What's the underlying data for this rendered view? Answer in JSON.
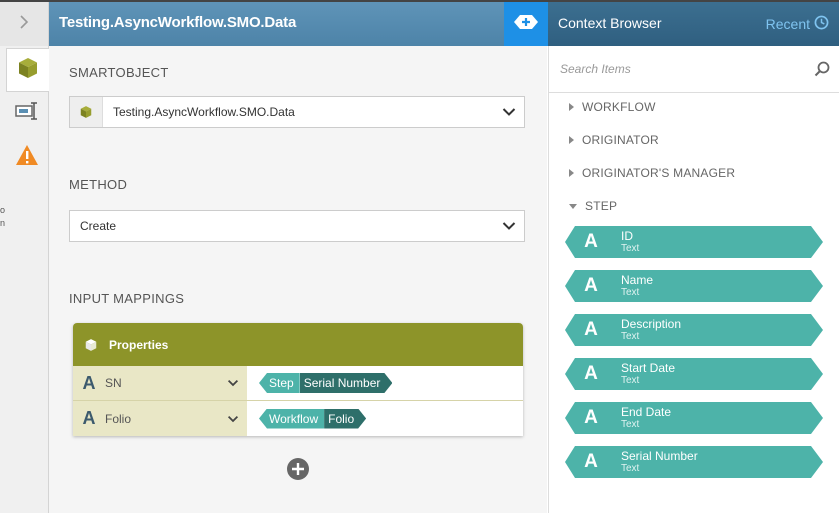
{
  "header": {
    "title": "Testing.AsyncWorkflow.SMO.Data"
  },
  "colors": {
    "header_blue": "#5b91b5",
    "add_button": "#1e90e6",
    "context_header": "#356586",
    "olive": "#8d9429",
    "teal": "#4db3a9",
    "teal_dark": "#2e6f6a"
  },
  "rail": {
    "expand_icon": "chevron-right-icon",
    "tabs": [
      "smartobject-cube-icon",
      "input-field-icon",
      "warning-icon"
    ]
  },
  "smartobject": {
    "label": "SMARTOBJECT",
    "value": "Testing.AsyncWorkflow.SMO.Data"
  },
  "method": {
    "label": "METHOD",
    "value": "Create"
  },
  "input_mappings": {
    "label": "INPUT MAPPINGS",
    "group_title": "Properties",
    "rows": [
      {
        "type_glyph": "A",
        "name": "SN",
        "token_context": "Step",
        "token_field": "Serial Number"
      },
      {
        "type_glyph": "A",
        "name": "Folio",
        "token_context": "Workflow",
        "token_field": "Folio"
      }
    ]
  },
  "context_browser": {
    "title": "Context Browser",
    "recent_label": "Recent",
    "search_placeholder": "Search Items",
    "tree": [
      {
        "label": "WORKFLOW",
        "expanded": false
      },
      {
        "label": "ORIGINATOR",
        "expanded": false
      },
      {
        "label": "ORIGINATOR'S MANAGER",
        "expanded": false
      },
      {
        "label": "STEP",
        "expanded": true
      }
    ],
    "step_fields": [
      {
        "glyph": "A",
        "name": "ID",
        "type": "Text"
      },
      {
        "glyph": "A",
        "name": "Name",
        "type": "Text"
      },
      {
        "glyph": "A",
        "name": "Description",
        "type": "Text"
      },
      {
        "glyph": "A",
        "name": "Start Date",
        "type": "Text"
      },
      {
        "glyph": "A",
        "name": "End Date",
        "type": "Text"
      },
      {
        "glyph": "A",
        "name": "Serial Number",
        "type": "Text"
      }
    ]
  }
}
